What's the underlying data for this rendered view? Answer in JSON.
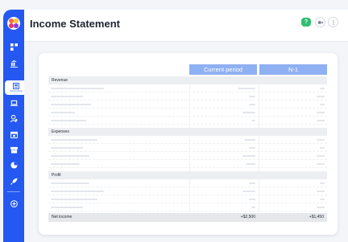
{
  "sidebar": {
    "logo": "brand-logo",
    "items": [
      {
        "icon": "dashboard-icon"
      },
      {
        "icon": "bank-icon"
      },
      {
        "icon": "accounting-icon",
        "label": "Accounting",
        "active": true
      },
      {
        "icon": "laptop-icon"
      },
      {
        "icon": "users-icon"
      },
      {
        "icon": "calendar-icon"
      },
      {
        "icon": "store-icon"
      },
      {
        "icon": "pie-chart-icon"
      },
      {
        "icon": "rocket-icon"
      },
      {
        "icon": "add-icon"
      }
    ]
  },
  "header": {
    "title": "Income Statement",
    "help_label": "?",
    "help_color": "#2fbf71",
    "icons": [
      "video-icon",
      "more-icon"
    ]
  },
  "table": {
    "columns": [
      "Current period",
      "N-1"
    ],
    "sections": [
      "Revenue",
      "Expenses",
      "Profit"
    ],
    "total_label": "Net income",
    "total_current": "+$2,500",
    "total_prev": "+$1,450"
  },
  "colors": {
    "sidebar": "#2458f1",
    "column_header": "#8fb0f2"
  }
}
